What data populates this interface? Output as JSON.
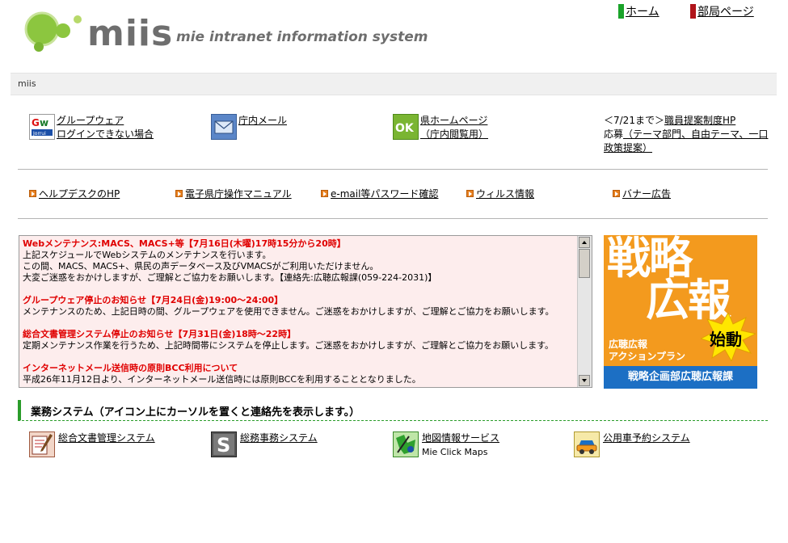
{
  "header": {
    "logo_name": "miis",
    "logo_subtitle": "mie intranet information system",
    "home_link": "ホーム",
    "dept_link": "部局ページ",
    "home_color": "#1aa32a",
    "dept_color": "#b0141a"
  },
  "breadcrumb": {
    "text": "miis"
  },
  "quick_links": {
    "groupware": {
      "icon": "groupware-icon",
      "label": "グループウェア",
      "sub": "ログインできない場合"
    },
    "mail": {
      "icon": "mail-icon",
      "label": "庁内メール"
    },
    "pref_home": {
      "icon": "ok-icon",
      "label": "県ホームページ",
      "sub": "（庁内閲覧用）"
    },
    "proposal": {
      "prefix": "＜7/21まで＞",
      "link": "職員提案制度HP",
      "text_before": "応募",
      "sublink": "（テーマ部門、自由テーマ、一口政策提案）"
    }
  },
  "nav_links": [
    {
      "label": "ヘルプデスクのHP"
    },
    {
      "label": "電子県庁操作マニュアル"
    },
    {
      "label": "e-mail等パスワード確認"
    },
    {
      "label": "ウィルス情報"
    },
    {
      "label": "バナー広告"
    }
  ],
  "notices": [
    {
      "title": "Webメンテナンス:MACS、MACS+等【7月16日(木曜)17時15分から20時】",
      "body": [
        "上記スケジュールでWebシステムのメンテナンスを行います。",
        "この間、MACS、MACS+、県民の声データベース及びVMACSがご利用いただけません。",
        "大変ご迷惑をおかけしますが、ご理解とご協力をお願いします。【連絡先:広聴広報課(059-224-2031)】"
      ]
    },
    {
      "title": "グループウェア停止のお知らせ【7月24日(金)19:00～24:00】",
      "body": [
        "メンテナンスのため、上記日時の間、グループウェアを使用できません。ご迷惑をおかけしますが、ご理解とご協力をお願いします。"
      ]
    },
    {
      "title": "総合文書管理システム停止のお知らせ【7月31日(金)18時～22時】",
      "body": [
        "定期メンテナンス作業を行うため、上記時間帯にシステムを停止します。ご迷惑をおかけしますが、ご理解とご協力をお願いします。"
      ]
    },
    {
      "title": "インターネットメール送信時の原則BCC利用について",
      "body": [
        "平成26年11月12日より、インターネットメール送信時には原則BCCを利用することとなりました。"
      ]
    }
  ],
  "banner": {
    "line1": "戦略",
    "line2": "広報",
    "small1": "広聴広報",
    "small2": "アクションプラン",
    "burst": "始動",
    "footer": "戦略企画部広聴広報課",
    "bg_color": "#f39a1e",
    "footer_color": "#1c6fc4"
  },
  "systems": {
    "title": "業務システム（アイコン上にカーソルを置くと連絡先を表示します。）",
    "items": [
      {
        "icon": "document-management-icon",
        "label": "総合文書管理システム"
      },
      {
        "icon": "general-affairs-icon",
        "label": "総務事務システム"
      },
      {
        "icon": "map-icon",
        "label": "地図情報サービス",
        "sub": "Mie Click Maps"
      },
      {
        "icon": "car-icon",
        "label": "公用車予約システム"
      }
    ]
  }
}
